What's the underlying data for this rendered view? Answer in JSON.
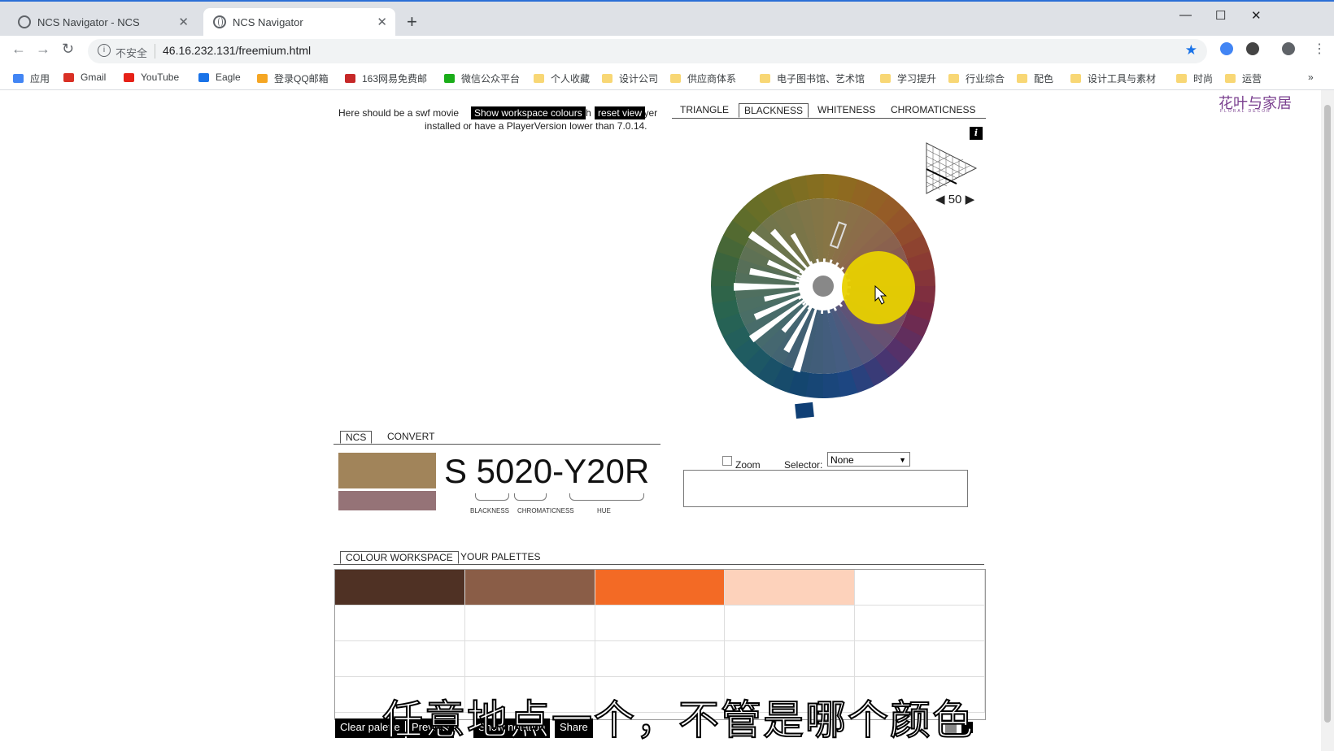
{
  "browser": {
    "tabs": [
      {
        "title": "NCS Navigator - NCS",
        "close": "✕"
      },
      {
        "title": "NCS Navigator",
        "close": "✕"
      }
    ],
    "new_tab": "+",
    "window_controls": {
      "minimize": "—",
      "maximize": "☐",
      "close": "✕"
    },
    "nav": {
      "back": "←",
      "forward": "→",
      "reload": "↻"
    },
    "address": {
      "security_label": "不安全",
      "url": "46.16.232.131/freemium.html",
      "bookmarked": "★"
    },
    "bookmarks": [
      {
        "label": "应用",
        "icon": "apps-grid-icon",
        "color": "#4285f4"
      },
      {
        "label": "Gmail",
        "icon": "gmail-icon",
        "color": "#d93025"
      },
      {
        "label": "YouTube",
        "icon": "youtube-icon",
        "color": "#e62117"
      },
      {
        "label": "Eagle",
        "icon": "eagle-icon",
        "color": "#1a73e8"
      },
      {
        "label": "登录QQ邮箱",
        "icon": "qq-mail-icon",
        "color": "#f5a623"
      },
      {
        "label": "163网易免费邮",
        "icon": "163-mail-icon",
        "color": "#c62828"
      },
      {
        "label": "微信公众平台",
        "icon": "wechat-icon",
        "color": "#1aad19"
      },
      {
        "label": "个人收藏",
        "icon": "folder-icon",
        "color": "#f8d775"
      },
      {
        "label": "设计公司",
        "icon": "folder-icon",
        "color": "#f8d775"
      },
      {
        "label": "供应商体系",
        "icon": "folder-icon",
        "color": "#f8d775"
      },
      {
        "label": "电子图书馆、艺术馆",
        "icon": "folder-icon",
        "color": "#f8d775"
      },
      {
        "label": "学习提升",
        "icon": "folder-icon",
        "color": "#f8d775"
      },
      {
        "label": "行业综合",
        "icon": "folder-icon",
        "color": "#f8d775"
      },
      {
        "label": "配色",
        "icon": "folder-icon",
        "color": "#f8d775"
      },
      {
        "label": "设计工具与素材",
        "icon": "folder-icon",
        "color": "#f8d775"
      },
      {
        "label": "时尚",
        "icon": "folder-icon",
        "color": "#f8d775"
      },
      {
        "label": "运营",
        "icon": "folder-icon",
        "color": "#f8d775"
      }
    ],
    "bookmarks_overflow": "»"
  },
  "logo": {
    "text": "花叶与家居",
    "sub": "FLORAL DECOR"
  },
  "flash_message": {
    "line1": "Here should be a swf movie",
    "line1_tail": "ayer",
    "line2": "installed or have a PlayerVersion lower than 7.0.14.",
    "show_workspace_btn": "Show workspace colours",
    "overlap_letter": "h",
    "reset_view_btn": "reset view"
  },
  "view_tabs": [
    "TRIANGLE",
    "BLACKNESS",
    "WHITENESS",
    "CHROMATICNESS"
  ],
  "active_view_tab": "BLACKNESS",
  "info_button": "i",
  "blackness_level": {
    "prev": "◀",
    "value": "50",
    "next": "▶"
  },
  "ncs_panel": {
    "tabs": [
      "NCS",
      "CONVERT"
    ],
    "code": "S 5020-Y20R",
    "labels": {
      "blackness": "BLACKNESS",
      "chromaticness": "CHROMATICNESS",
      "hue": "HUE"
    },
    "swatch_main": "#a1845a",
    "swatch_sub": "#957377"
  },
  "zoom": {
    "label": "Zoom",
    "selector_label": "Selector:",
    "selector_value": "None",
    "checked": false
  },
  "workspace": {
    "tabs": [
      "COLOUR WORKSPACE",
      "YOUR PALETTES"
    ],
    "swatches": [
      "#4f3124",
      "#8a5d47",
      "#f36a25",
      "#fdd2bb",
      "#ffffff"
    ]
  },
  "bottom_buttons": [
    "Clear palette",
    "Preview",
    "Show notation",
    "Share"
  ],
  "subtitle": "任意地点一个，不管是哪个颜色"
}
